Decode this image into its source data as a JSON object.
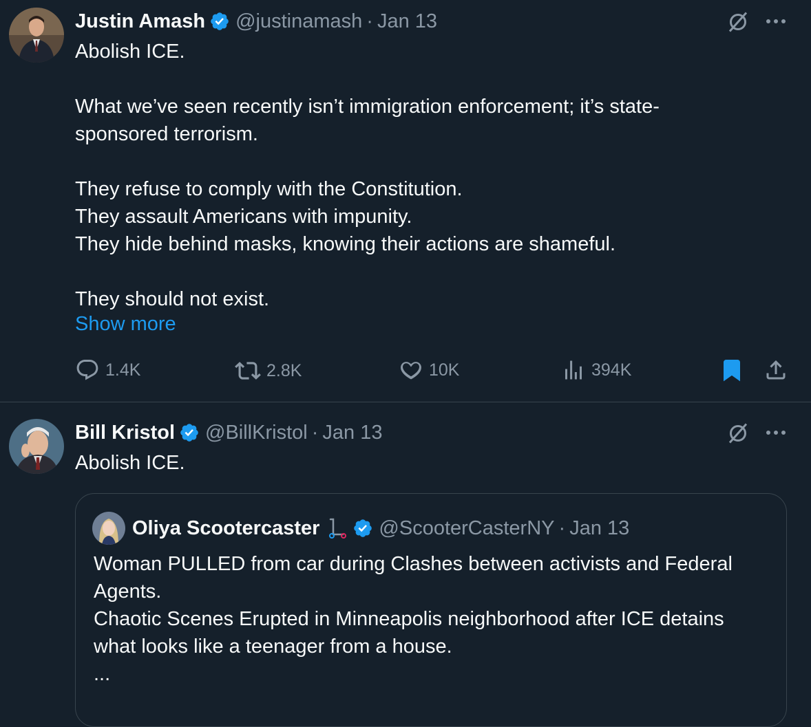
{
  "tweet1": {
    "name": "Justin Amash",
    "handle": "@justinamash",
    "separator": "·",
    "date": "Jan 13",
    "text": "Abolish ICE.\n\nWhat we’ve seen recently isn’t immigration enforcement; it’s state-\nsponsored terrorism.\n\nThey refuse to comply with the Constitution.\nThey assault Americans with impunity.\nThey hide behind masks, knowing their actions are shameful.\n\nThey should not exist.",
    "show_more": "Show more",
    "replies": "1.4K",
    "reposts": "2.8K",
    "likes": "10K",
    "views": "394K",
    "more_icon": "more-icon",
    "grok_icon": "grok-icon"
  },
  "tweet2": {
    "name": "Bill Kristol",
    "handle": "@BillKristol",
    "separator": "·",
    "date": "Jan 13",
    "text": "Abolish ICE."
  },
  "quote": {
    "name": "Oliya Scootercaster",
    "handle": "@ScooterCasterNY",
    "separator": "·",
    "date": "Jan 13",
    "text": "Woman PULLED from car during Clashes between activists and Federal\nAgents.\nChaotic Scenes Erupted in Minneapolis neighborhood after ICE detains\nwhat looks like a teenager from a house.\n..."
  },
  "colors": {
    "background": "#15202b",
    "text": "#f7f9f9",
    "secondary": "#8b98a5",
    "accent": "#1d9bf0",
    "divider": "#38444d"
  }
}
